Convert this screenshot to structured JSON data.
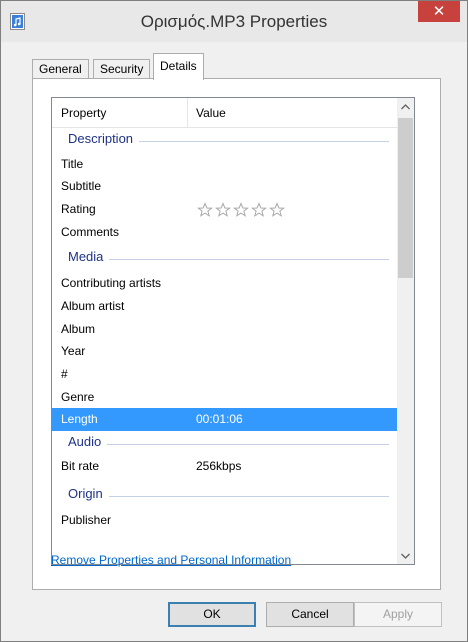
{
  "window": {
    "title": "Ορισμός.MP3 Properties",
    "close_label": "✕"
  },
  "tabs": [
    {
      "label": "General"
    },
    {
      "label": "Security"
    },
    {
      "label": "Details",
      "active": true
    }
  ],
  "list": {
    "header": {
      "property": "Property",
      "value": "Value"
    },
    "groups": {
      "description": "Description",
      "media": "Media",
      "audio": "Audio",
      "origin": "Origin"
    },
    "rows": {
      "title": {
        "label": "Title",
        "value": ""
      },
      "subtitle": {
        "label": "Subtitle",
        "value": ""
      },
      "rating": {
        "label": "Rating",
        "stars": 0,
        "max_stars": 5
      },
      "comments": {
        "label": "Comments",
        "value": ""
      },
      "contributing_artists": {
        "label": "Contributing artists",
        "value": ""
      },
      "album_artist": {
        "label": "Album artist",
        "value": ""
      },
      "album": {
        "label": "Album",
        "value": ""
      },
      "year": {
        "label": "Year",
        "value": ""
      },
      "track": {
        "label": "#",
        "value": ""
      },
      "genre": {
        "label": "Genre",
        "value": ""
      },
      "length": {
        "label": "Length",
        "value": "00:01:06",
        "selected": true
      },
      "bit_rate": {
        "label": "Bit rate",
        "value": "256kbps"
      },
      "publisher": {
        "label": "Publisher",
        "value": ""
      }
    }
  },
  "remove_link": "Remove Properties and Personal Information",
  "buttons": {
    "ok": "OK",
    "cancel": "Cancel",
    "apply": "Apply"
  },
  "colors": {
    "selection": "#3399ff",
    "group_label": "#1e3287",
    "close_button": "#c7413d",
    "link": "#0066cc"
  }
}
